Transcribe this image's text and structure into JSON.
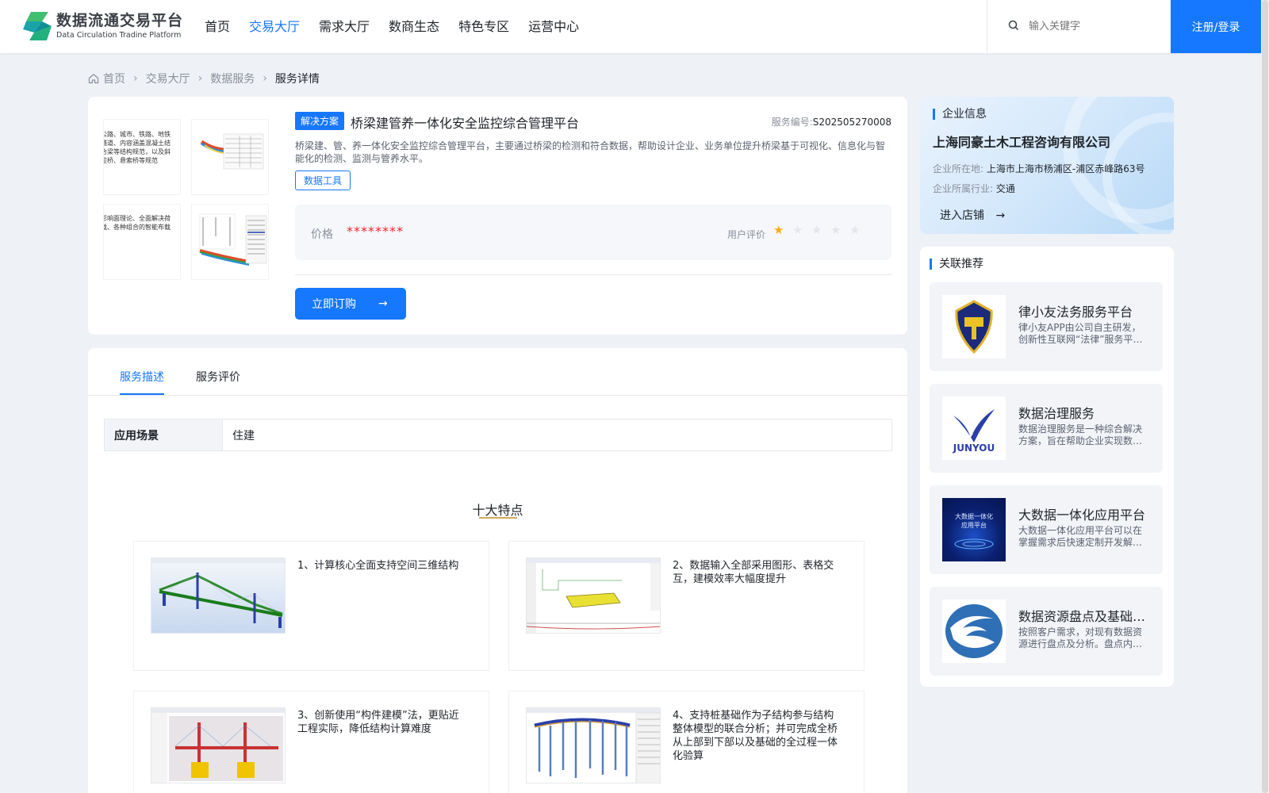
{
  "brand": {
    "name_cn": "数据流通交易平台",
    "name_en": "Data Circulation Tradine Platform"
  },
  "nav": {
    "items": [
      {
        "label": "首页",
        "active": false
      },
      {
        "label": "交易大厅",
        "active": true
      },
      {
        "label": "需求大厅",
        "active": false
      },
      {
        "label": "数商生态",
        "active": false
      },
      {
        "label": "特色专区",
        "active": false
      },
      {
        "label": "运营中心",
        "active": false
      }
    ]
  },
  "search": {
    "placeholder": "输入关键字",
    "icon": "search-icon"
  },
  "auth": {
    "label": "注册/登录"
  },
  "breadcrumb": {
    "items": [
      "首页",
      "交易大厅",
      "数据服务"
    ],
    "current": "服务详情",
    "separator": "›"
  },
  "product": {
    "tag": "解决方案",
    "title": "桥梁建管养一体化安全监控综合管理平台",
    "service_no_label": "服务编号:",
    "service_no": "S202505270008",
    "description": "桥梁建、管、养一体化安全监控综合管理平台，主要通过桥梁的检测和符合数据，帮助设计企业、业务单位提升桥梁基于可视化、信息化与智能化的检测、监测与管养水平。",
    "category_tag": "数据工具",
    "price_label": "价格",
    "price_value": "********",
    "rating_label": "用户评价",
    "rating": 1,
    "rating_max": 5,
    "buy_label": "立即订购",
    "thumbs": [
      {
        "text": "公路、城市、铁路、地铁隧道、内容涵盖混凝土结合梁等结构规范，以及斜拉桥、悬索桥等规范"
      },
      {
        "text": ""
      },
      {
        "text": "影响面理论、全面解决荷载、各种组合的智能布载"
      },
      {
        "text": ""
      }
    ]
  },
  "enterprise": {
    "section_title": "企业信息",
    "name": "上海同豪土木工程咨询有限公司",
    "location_label": "企业所在地:",
    "location": "上海市上海市杨浦区-浦区赤峰路63号",
    "industry_label": "企业所属行业:",
    "industry": "交通",
    "enter_label": "进入店铺"
  },
  "recommend": {
    "section_title": "关联推荐",
    "items": [
      {
        "title": "律小友法务服务平台",
        "desc": "律小友APP由公司自主研发，创新性互联网“法律”服务平台，为用户提供一站式法律服务",
        "icon": "gavel-shield-logo"
      },
      {
        "title": "数据治理服务",
        "desc": "数据治理服务是一种综合解决方案，旨在帮助企业实现数据的规范化管理与价值提升",
        "icon": "junyou-logo",
        "logo_text": "JUNYOU"
      },
      {
        "title": "大数据一体化应用平台",
        "desc": "大数据一体化应用平台可以在掌握需求后快速定制开发解决方案的应用平台",
        "icon": "bigdata-cover",
        "cover_text": "大数据一体化\n应用平台"
      },
      {
        "title": "数据资源盘点及基础数据治理服务",
        "desc": "按照客户需求，对现有数据资源进行盘点及分析。盘点内容：数据资源目录等",
        "icon": "swirl-logo"
      }
    ]
  },
  "detail": {
    "tabs": [
      {
        "label": "服务描述",
        "active": true
      },
      {
        "label": "服务评价",
        "active": false
      }
    ],
    "scene_key": "应用场景",
    "scene_value": "住建",
    "features_title": "十大特点",
    "features": [
      {
        "text": "1、计算核心全面支持空间三维结构"
      },
      {
        "text": "2、数据输入全部采用图形、表格交互，建模效率大幅度提升"
      },
      {
        "text": "3、创新使用“构件建模”法，更贴近工程实际，降低结构计算难度"
      },
      {
        "text": "4、支持桩基础作为子结构参与结构整体模型的联合分析；并可完成全桥从上部到下部以及基础的全过程一体化验算"
      }
    ]
  },
  "colors": {
    "primary": "#1677ff",
    "price": "#f5222d",
    "star_on": "#faad14",
    "star_off": "#e3e6eb",
    "page_bg": "#eef1f6"
  }
}
